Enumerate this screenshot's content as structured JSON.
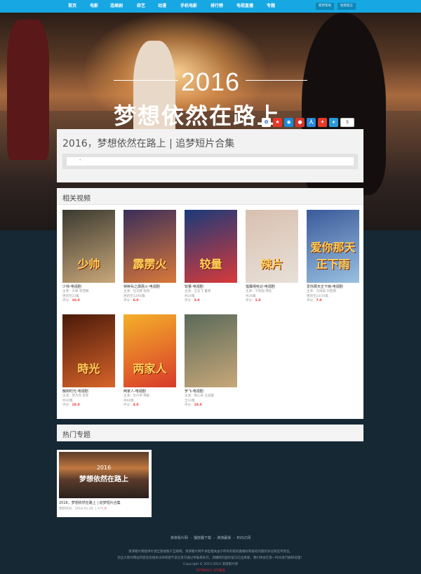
{
  "nav": {
    "items": [
      "首页",
      "电影",
      "连续剧",
      "综艺",
      "动漫",
      "手机电影",
      "排行榜",
      "电视直播",
      "专题"
    ],
    "help": "使用帮助",
    "feedback": "给我留言"
  },
  "hero": {
    "year": "2016",
    "slogan": "梦想依然在路上",
    "share_count": "5"
  },
  "topic": {
    "title": "2016，梦想依然在路上 | 追梦短片合集",
    "intro": "-"
  },
  "related": {
    "heading": "相关视频",
    "videos": [
      {
        "title": "少帅-电视剧",
        "actors": "主演：文章 宋雪娜",
        "status": "更新至33集",
        "score_label": "评分：",
        "score": "10.0",
        "poster_text": "少帅",
        "colors": [
          "#3b3a30",
          "#c9a77a"
        ]
      },
      {
        "title": "特种兵之霹雳火-电视剧",
        "actors": "主演：任天野 程煜",
        "status": "更新至33/60集",
        "score_label": "评分：",
        "score": "6.0",
        "poster_text": "霹雳火",
        "colors": [
          "#3a2e5a",
          "#d9783a"
        ]
      },
      {
        "title": "较量-电视剧",
        "actors": "主演：王志飞 董勇",
        "status": "共24集",
        "score_label": "评分：",
        "score": "3.0",
        "poster_text": "较量",
        "colors": [
          "#1a3a7a",
          "#d83a3a"
        ]
      },
      {
        "title": "猎鹰嘻哈记-电视剧",
        "actors": "主演：于明加 韩栋",
        "status": "共26集",
        "score_label": "评分：",
        "score": "1.0",
        "poster_text": "辣片",
        "colors": [
          "#d8c0b0",
          "#e8e0d8"
        ]
      },
      {
        "title": "爱你那天正下雨-电视剧",
        "actors": "主演：刘涛妞 刘若娜",
        "status": "更新至23/34集",
        "score_label": "评分：",
        "score": "7.0",
        "poster_text": "爱你那天正下雨",
        "colors": [
          "#3a5a9a",
          "#9ac0e0"
        ]
      },
      {
        "title": "触到时光-电视剧",
        "actors": "主演：贾乃亮 李菲",
        "status": "共30集",
        "score_label": "评分：",
        "score": "10.0",
        "poster_text": "時光",
        "colors": [
          "#4a1a0a",
          "#d8642a"
        ]
      },
      {
        "title": "两家人-电视剧",
        "actors": "主演：文兴宇 韩影",
        "status": "共60集",
        "score_label": "评分：",
        "score": "4.0",
        "poster_text": "两家人",
        "colors": [
          "#f4b02a",
          "#d83a2a"
        ]
      },
      {
        "title": "罗飞-电视剧",
        "actors": "主演：邱心宋 立成康",
        "status": "全33集",
        "score_label": "评分：",
        "score": "10.0",
        "poster_text": "",
        "colors": [
          "#5a6a5a",
          "#c8a878"
        ]
      }
    ]
  },
  "topics": {
    "heading": "热门专题",
    "card": {
      "year": "2016",
      "slogan": "梦想依然在路上",
      "title": "2016，梦想依然在路上 | 追梦短片合集",
      "meta_label": "更新时间：",
      "date": "2016-01-28",
      "views_label": "人气",
      "views": "0"
    }
  },
  "footer": {
    "links": [
      "演演看片网",
      "播放器下载",
      "演演赢得",
      "RSS订阅"
    ],
    "line1": "演演看片网提供片源全部收集于互联网，演演看片网不承担相关由于所有的版权搬播权和服权问题的争议和连带责任。",
    "line2": "您应大家对网站内容违反相关法律或者不良信息可通过举报来处罚，演播网页面的留言红出来版，我们将会在第一时间进行删除处理！",
    "copyright": "Copyright © 2013-2014 演演看片网",
    "icp": "78780023",
    "icp_suffix": "ICP备案"
  },
  "colors": {
    "nav": "#17a7e2",
    "score": "#e33333",
    "footer": "#152834"
  }
}
